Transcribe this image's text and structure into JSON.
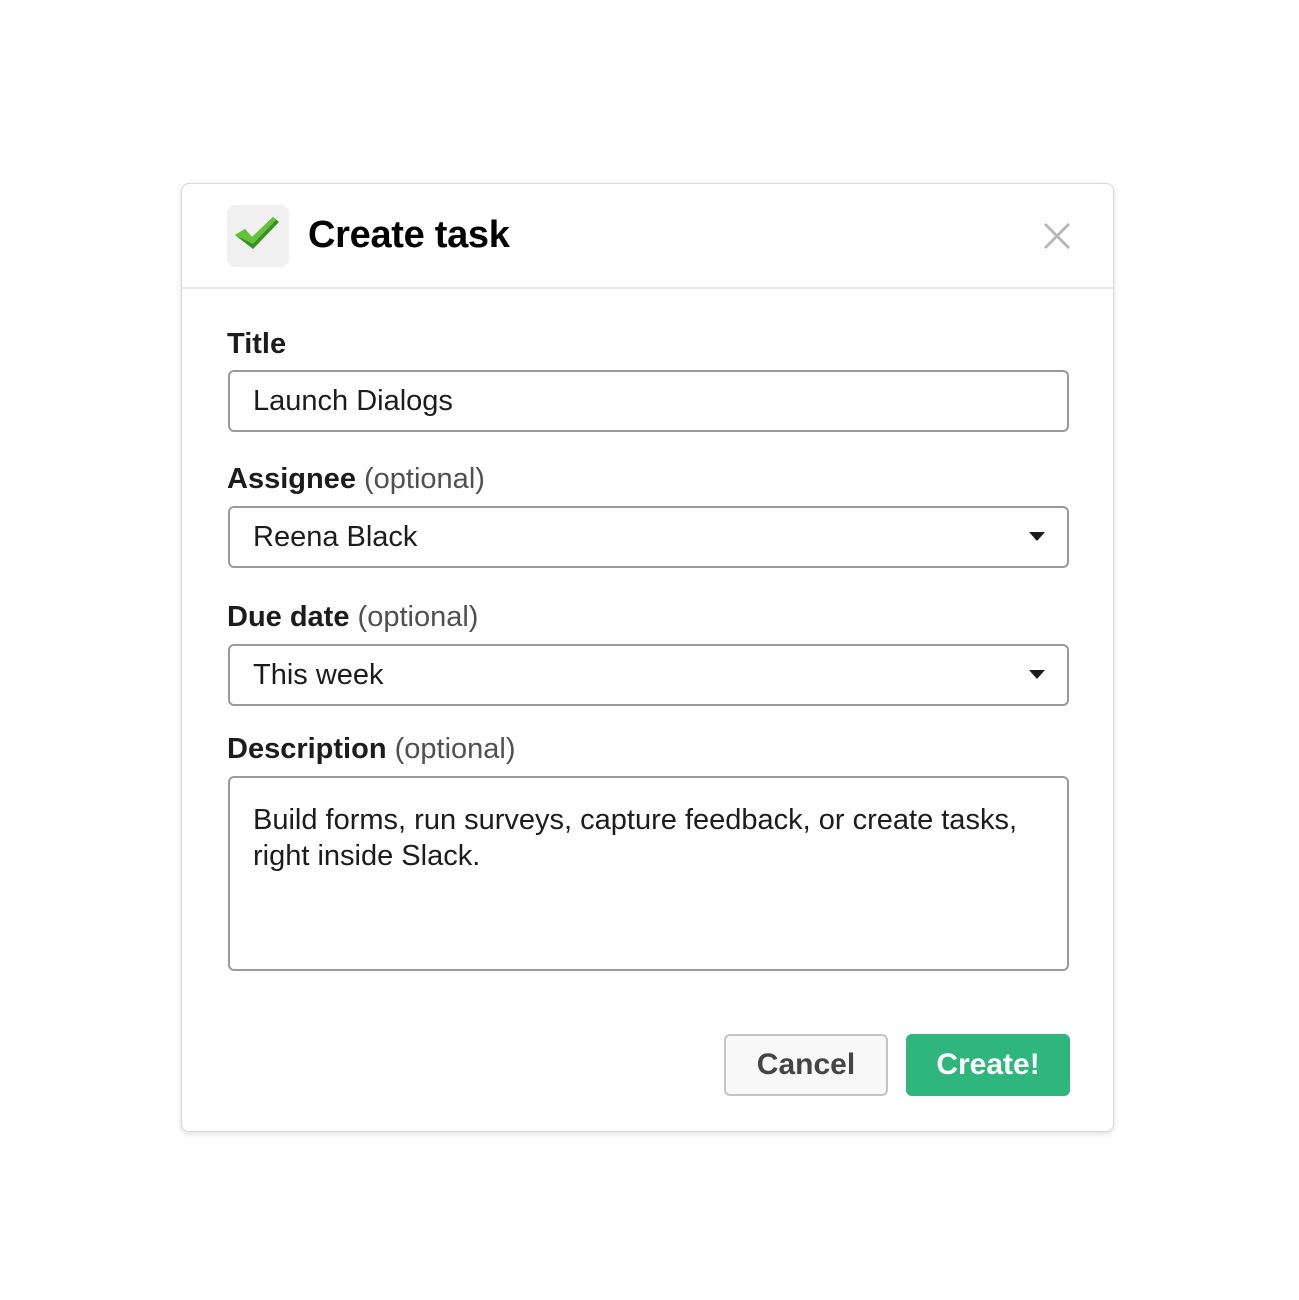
{
  "dialog": {
    "title": "Create task",
    "app_icon": "checkmark-icon",
    "close_icon": "close-icon"
  },
  "fields": {
    "title": {
      "label": "Title",
      "value": "Launch Dialogs"
    },
    "assignee": {
      "label": "Assignee",
      "optional": "(optional)",
      "value": "Reena Black"
    },
    "due_date": {
      "label": "Due date",
      "optional": "(optional)",
      "value": "This week"
    },
    "description": {
      "label": "Description",
      "optional": "(optional)",
      "value": "Build forms, run surveys, capture feedback, or create tasks, right inside Slack."
    }
  },
  "buttons": {
    "cancel": "Cancel",
    "create": "Create!"
  },
  "colors": {
    "primary": "#2eb67d",
    "check_green": "#4caa2c"
  }
}
